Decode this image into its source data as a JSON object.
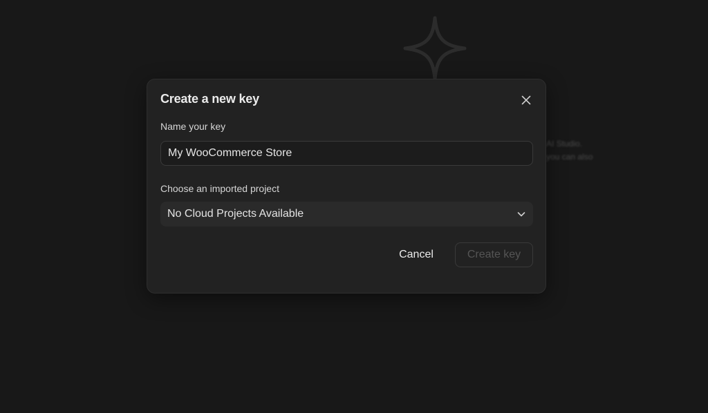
{
  "background": {
    "sparkle_icon": "sparkle-icon",
    "text_lines": [
      "AI Studio.",
      "you can also"
    ]
  },
  "dialog": {
    "title": "Create a new key",
    "close_icon": "close-icon",
    "name_label": "Name your key",
    "name_value": "My WooCommerce Store",
    "project_label": "Choose an imported project",
    "project_selected": "No Cloud Projects Available",
    "chevron_icon": "chevron-down-icon",
    "cancel_label": "Cancel",
    "create_label": "Create key"
  },
  "colors": {
    "background": "#181818",
    "dialog": "#222222",
    "disabled_text": "#555555"
  }
}
